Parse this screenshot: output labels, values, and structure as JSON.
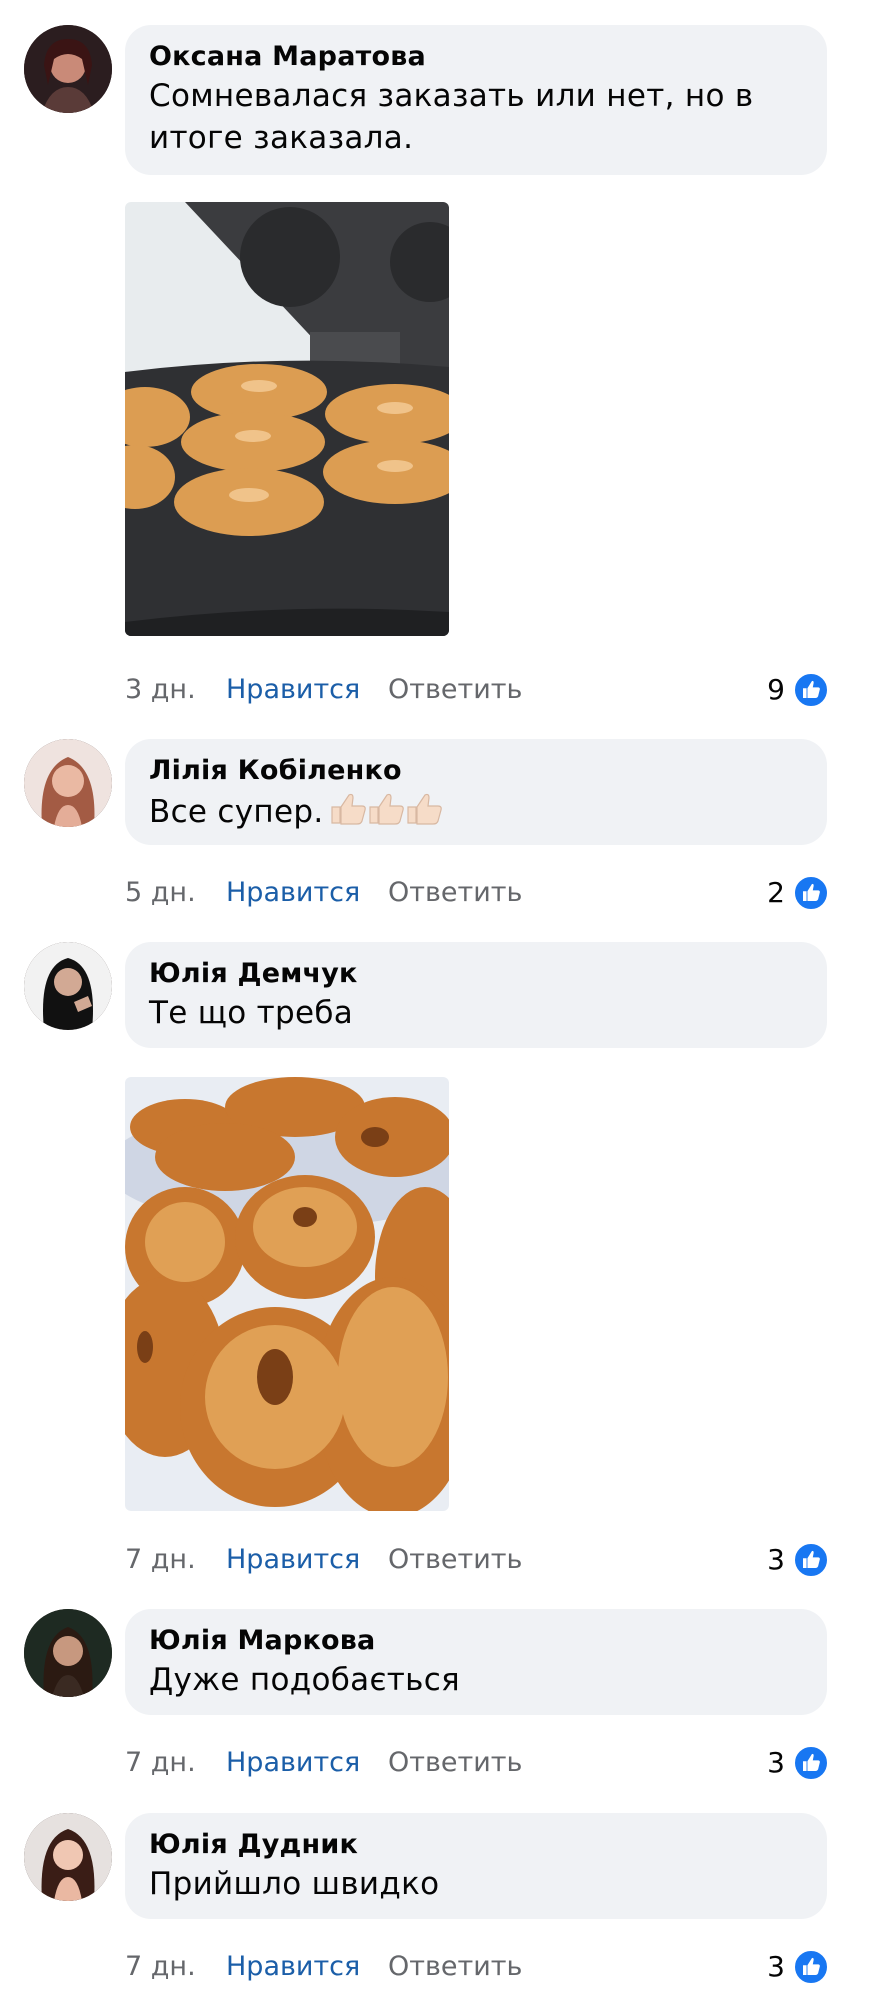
{
  "comments": [
    {
      "author": "Оксана Маратова",
      "text": "Сомневалася заказать или нет, но в итоге заказала.",
      "time": "3 дн.",
      "like_label": "Нравится",
      "reply_label": "Ответить",
      "likes": "9",
      "photo": "donut-maker-photo"
    },
    {
      "author": "Лілія Кобіленко",
      "text": "Все супер.",
      "emoji": "thumbs-up x3",
      "time": "5 дн.",
      "like_label": "Нравится",
      "reply_label": "Ответить",
      "likes": "2"
    },
    {
      "author": "Юлія Демчук",
      "text": "Те що треба",
      "time": "7 дн.",
      "like_label": "Нравится",
      "reply_label": "Ответить",
      "likes": "3",
      "photo": "fried-donuts-photo"
    },
    {
      "author": "Юлія Маркова",
      "text": "Дуже подобається",
      "time": "7 дн.",
      "like_label": "Нравится",
      "reply_label": "Ответить",
      "likes": "3"
    },
    {
      "author": "Юлія Дудник",
      "text": "Прийшло швидко",
      "time": "7 дн.",
      "like_label": "Нравится",
      "reply_label": "Ответить",
      "likes": "3"
    }
  ],
  "colors": {
    "bubble": "#f0f2f5",
    "like_link": "#1b5ea8",
    "like_icon": "#1877f2",
    "meta_text": "#65676b"
  }
}
